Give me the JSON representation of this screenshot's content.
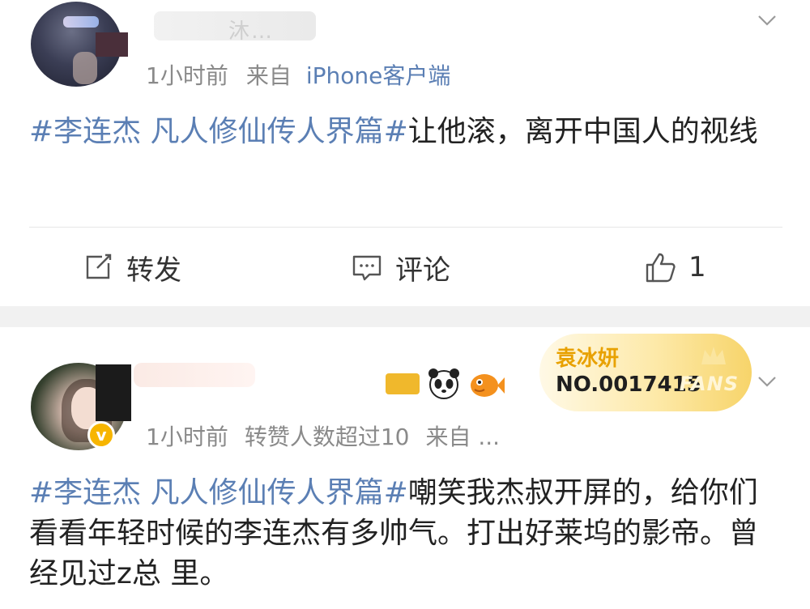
{
  "post1": {
    "username": "沐…",
    "time": "1小时前",
    "from_label": "来自",
    "source": "iPhone客户端",
    "hashtag": "#李连杰 凡人修仙传人界篇#",
    "body": "让他滚，离开中国人的视线",
    "actions": {
      "repost_label": "转发",
      "comment_label": "评论",
      "like_count": "1"
    }
  },
  "post2": {
    "time": "1小时前",
    "repost_info": "转赞人数超过10",
    "from_label": "来自 ...",
    "fans_badge": {
      "name": "袁冰妍",
      "number": "NO.0017415",
      "label": "FANS"
    },
    "hashtag": "#李连杰 凡人修仙传人界篇#",
    "body": "嘲笑我杰叔开屏的，给你们看看年轻时候的李连杰有多帅气。打出好莱坞的影帝。曾经见过z总 里。"
  },
  "icons": [
    "chevron-down-icon",
    "repost-icon",
    "comment-icon",
    "like-icon",
    "folder-emoji-icon",
    "panda-emoji-icon",
    "fish-emoji-icon",
    "verified-icon"
  ],
  "colors": {
    "link": "#5b7fb4",
    "meta": "#8a8a8a",
    "text": "#222222",
    "badge_gold": "#e8a100",
    "separator": "#f1f1f1"
  }
}
